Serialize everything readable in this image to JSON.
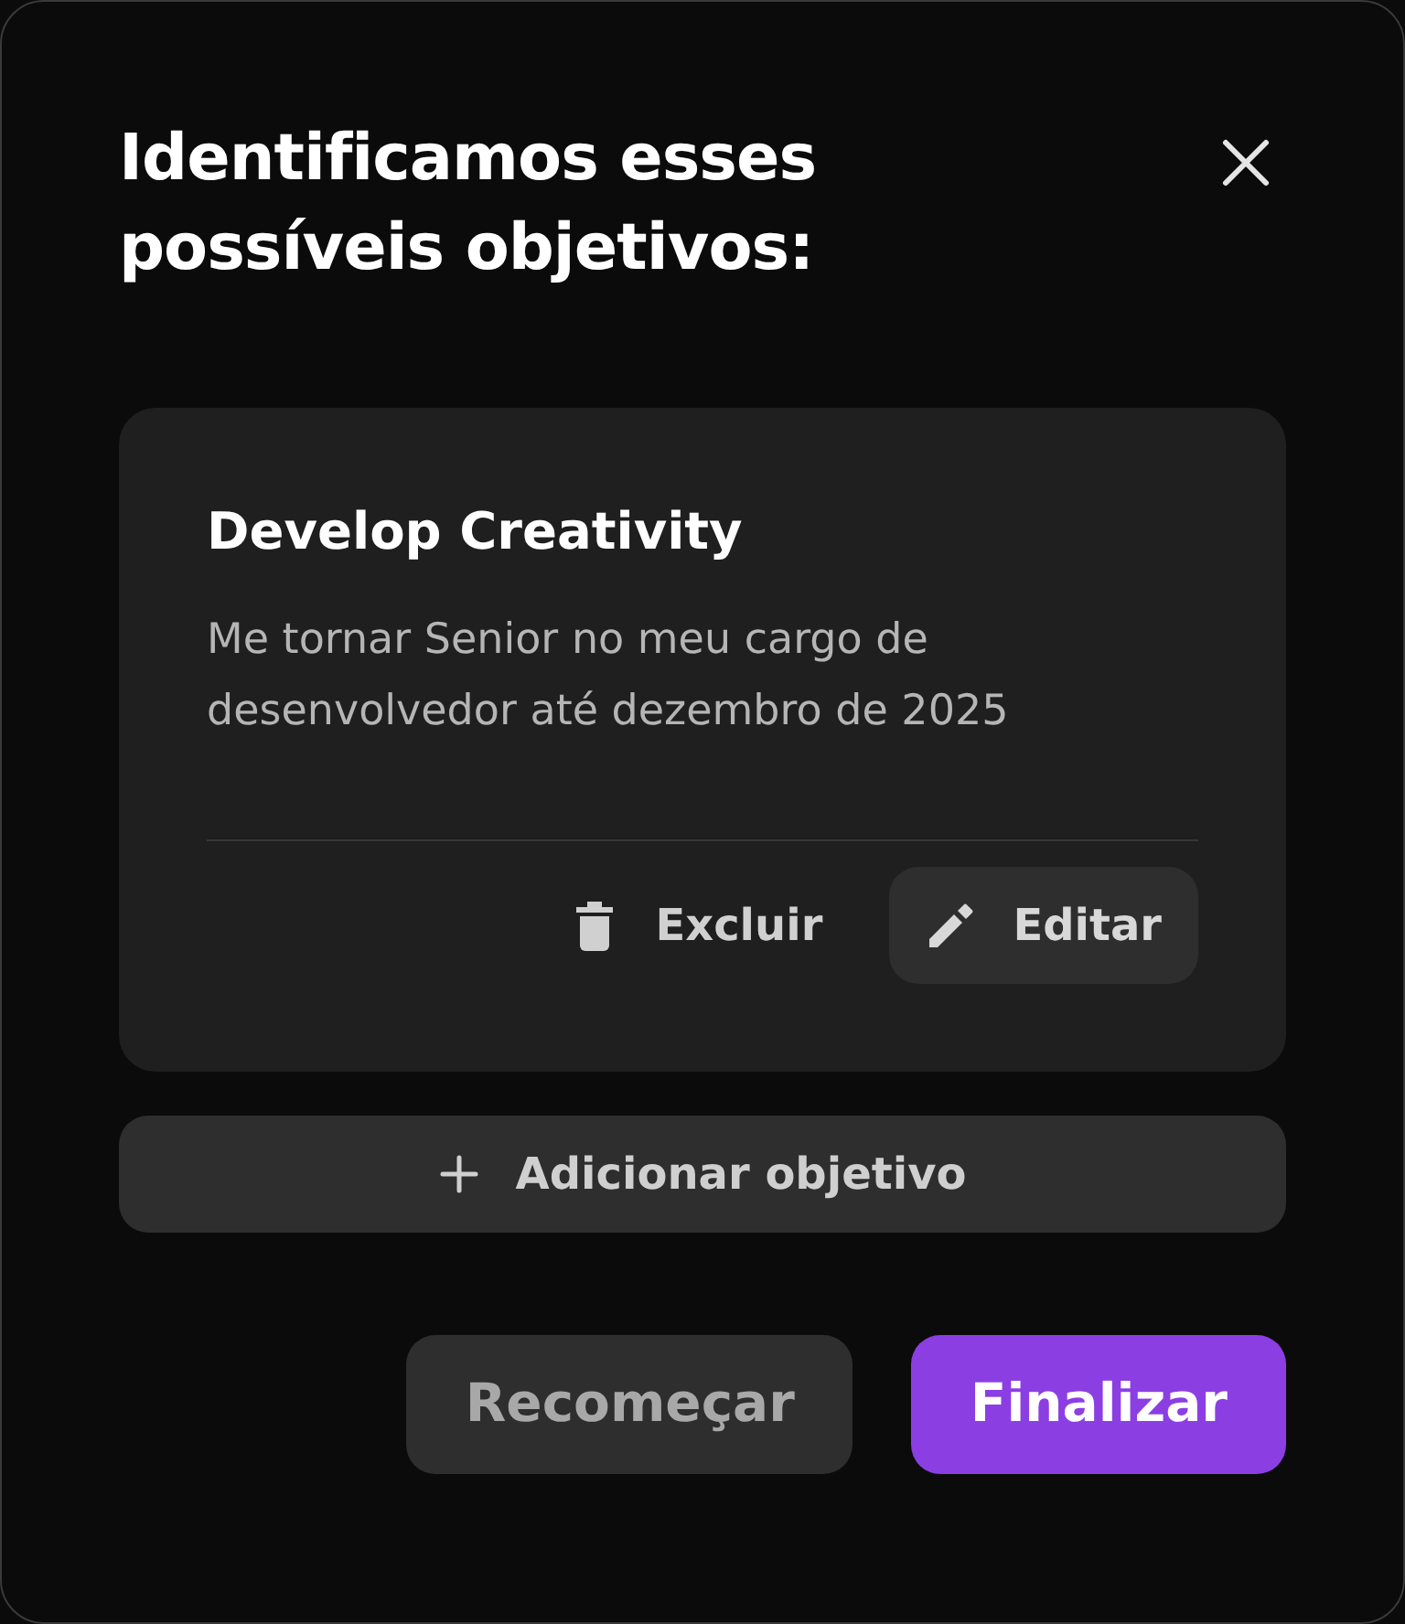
{
  "dialog": {
    "title": "Identificamos esses possíveis objetivos:"
  },
  "goals": [
    {
      "title": "Develop Creativity",
      "description": "Me tornar Senior no meu cargo de desenvolvedor até dezembro de 2025",
      "actions": [
        {
          "label": "Excluir",
          "kind": "delete"
        },
        {
          "label": "Editar",
          "kind": "edit"
        }
      ]
    }
  ],
  "add_button": {
    "label": "Adicionar objetivo"
  },
  "footer_buttons": [
    {
      "label": "Recomeçar",
      "kind": "secondary"
    },
    {
      "label": "Finalizar",
      "kind": "primary"
    }
  ]
}
